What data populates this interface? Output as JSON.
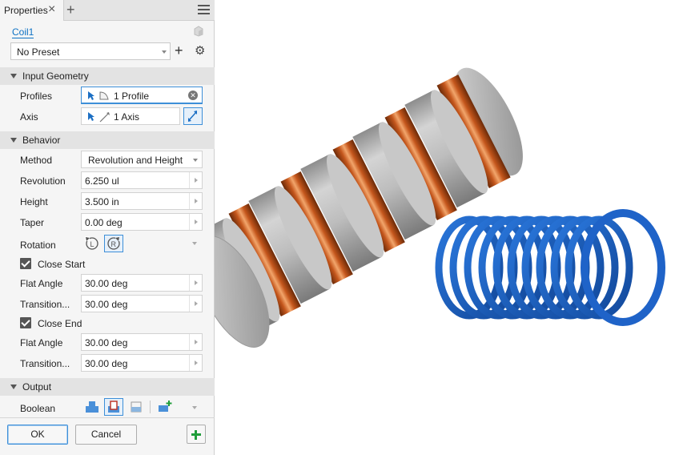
{
  "tab": {
    "title": "Properties",
    "close": "×",
    "add": "+"
  },
  "feature": {
    "name": "Coil1"
  },
  "preset": {
    "value": "No Preset",
    "add": "+",
    "gear": "⚙"
  },
  "sections": {
    "input_geometry": "Input Geometry",
    "behavior": "Behavior",
    "output": "Output"
  },
  "input_geometry": {
    "profiles_label": "Profiles",
    "profiles_value": "1 Profile",
    "axis_label": "Axis",
    "axis_value": "1 Axis"
  },
  "behavior": {
    "method_label": "Method",
    "method_value": "Revolution and Height",
    "revolution_label": "Revolution",
    "revolution_value": "6.250 ul",
    "height_label": "Height",
    "height_value": "3.500 in",
    "taper_label": "Taper",
    "taper_value": "0.00 deg",
    "rotation_label": "Rotation",
    "close_start_label": "Close Start",
    "close_start_checked": true,
    "flat_angle_start_label": "Flat Angle",
    "flat_angle_start_value": "30.00 deg",
    "transition_start_label": "Transition...",
    "transition_start_value": "30.00 deg",
    "close_end_label": "Close End",
    "close_end_checked": true,
    "flat_angle_end_label": "Flat Angle",
    "flat_angle_end_value": "30.00 deg",
    "transition_end_label": "Transition...",
    "transition_end_value": "30.00 deg"
  },
  "output": {
    "boolean_label": "Boolean"
  },
  "buttons": {
    "ok": "OK",
    "cancel": "Cancel"
  },
  "colors": {
    "accent": "#3d8fd8",
    "copper": "#c4561c",
    "steel": "#b9b9b9",
    "spring_blue": "#1a5fc4",
    "apply_green": "#1f9d3a"
  }
}
